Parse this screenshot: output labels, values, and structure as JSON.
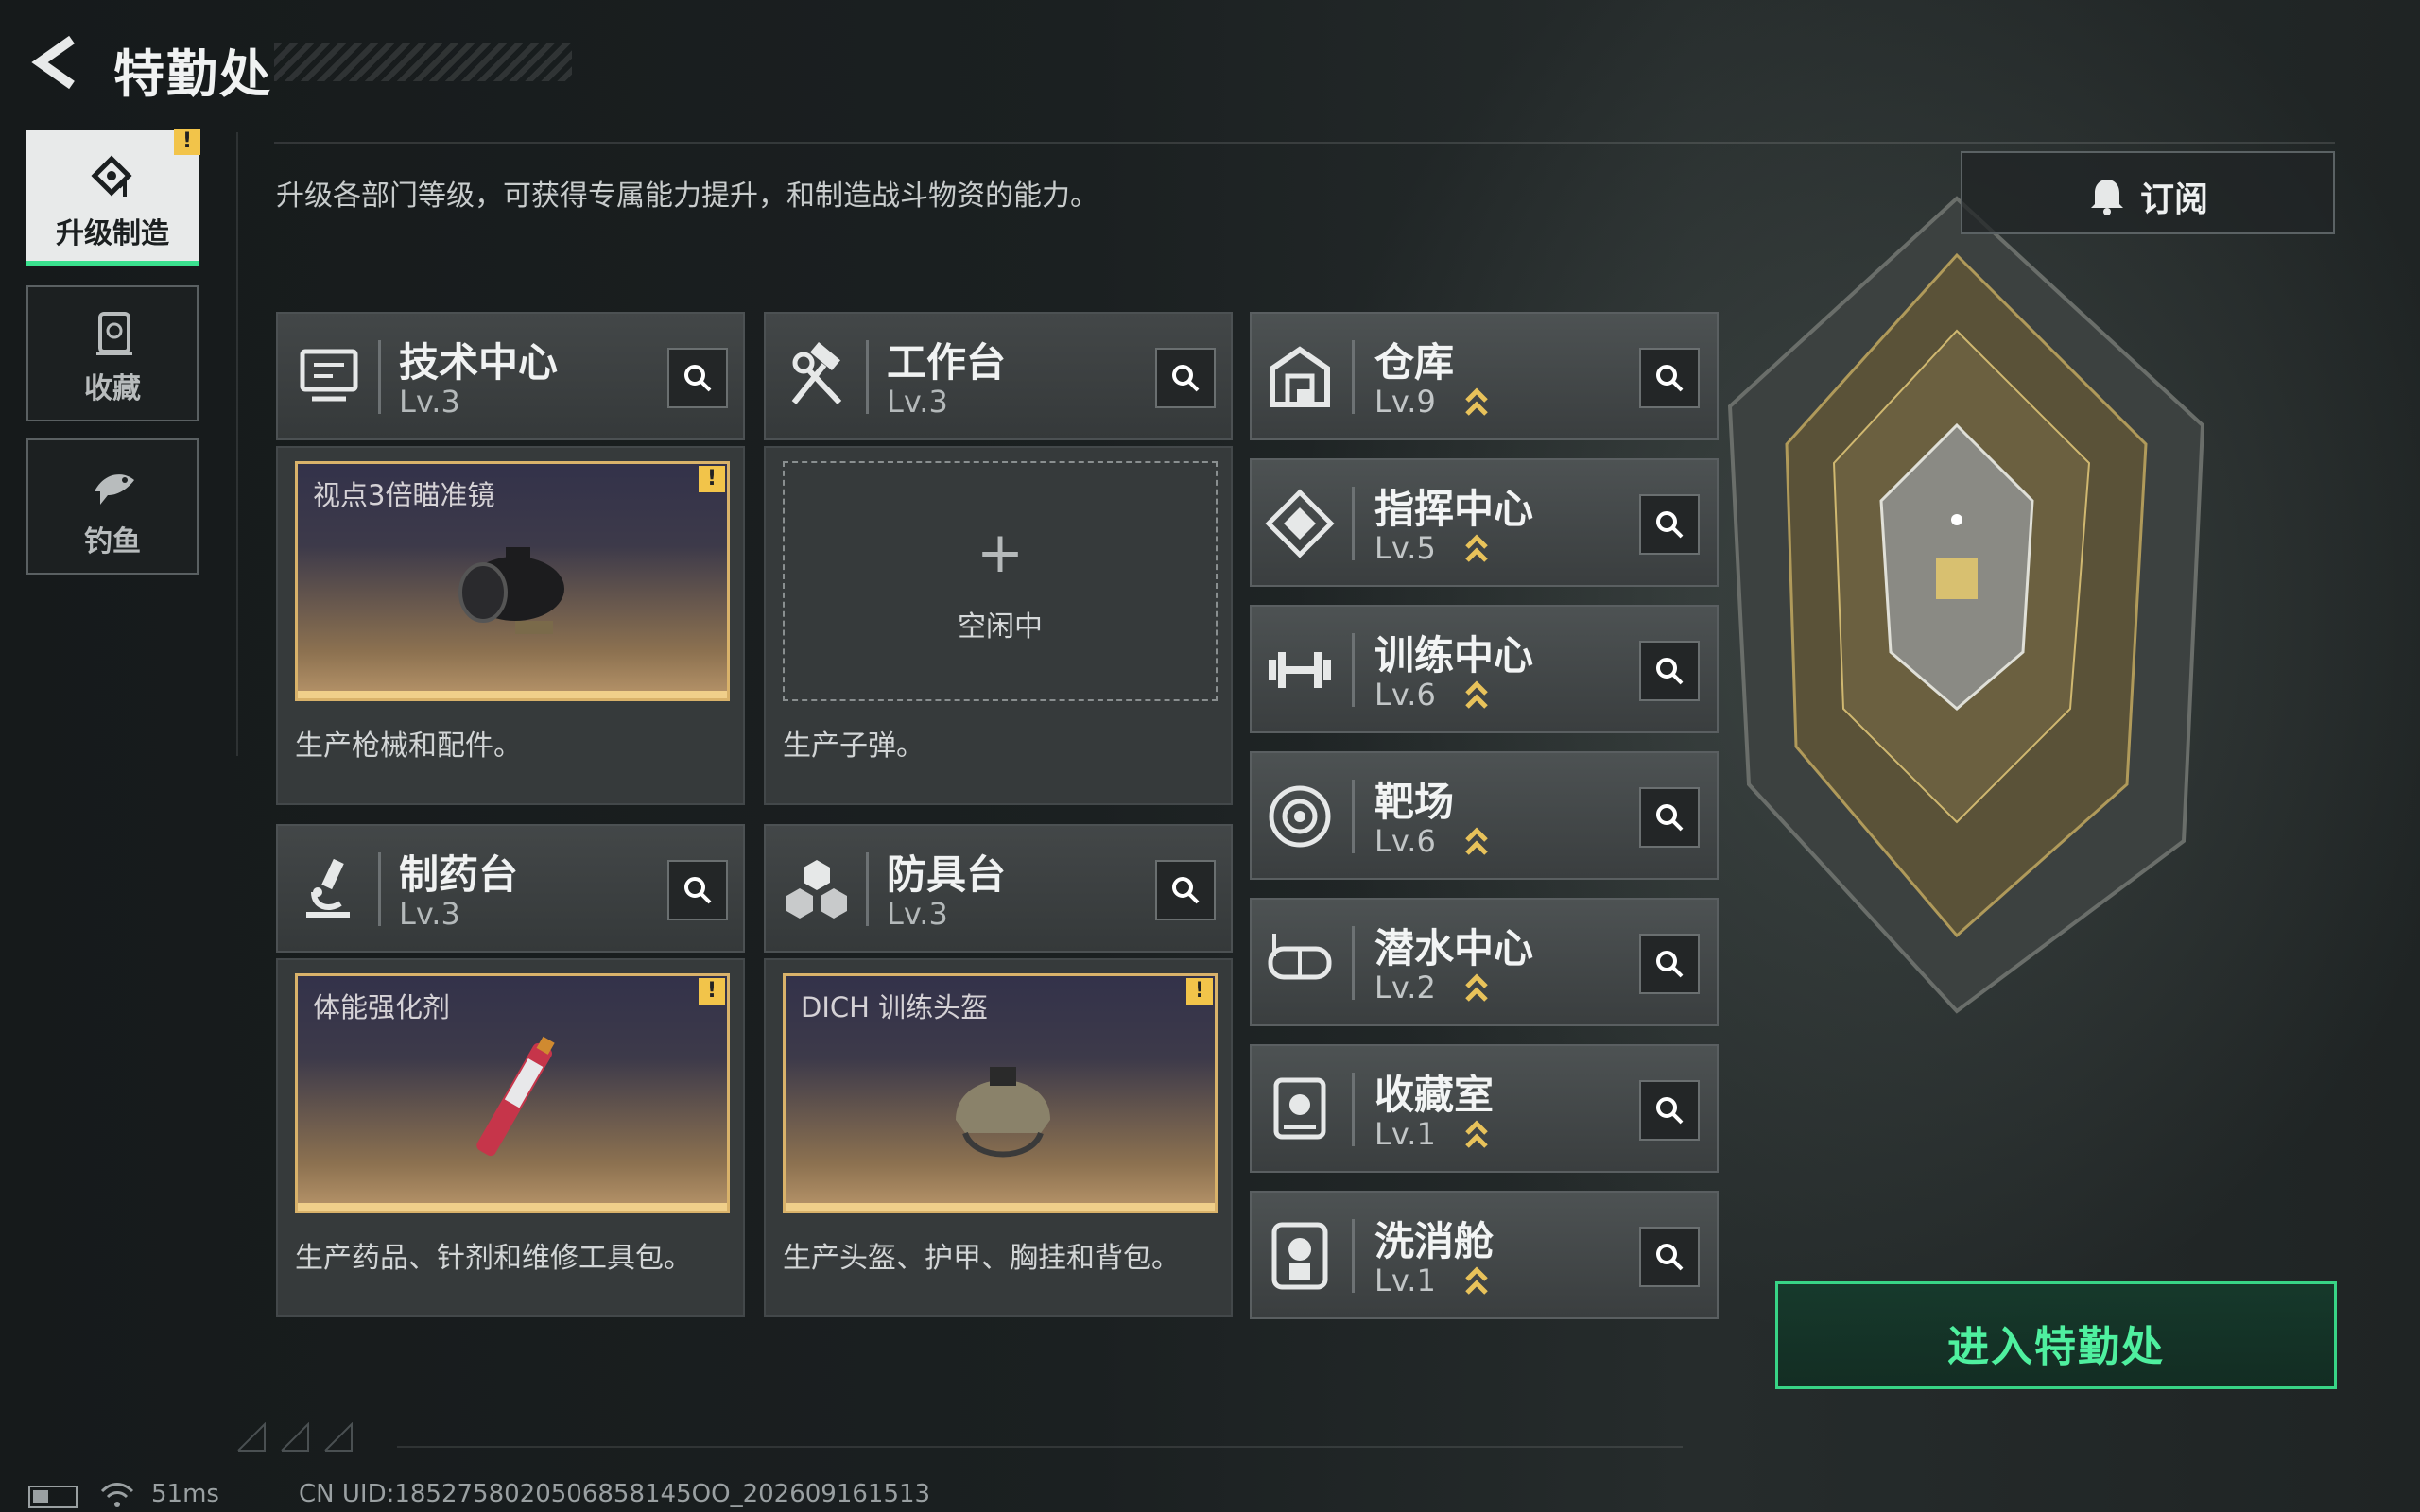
{
  "header": {
    "title": "特勤处",
    "subtitle": "升级各部门等级，可获得专属能力提升，和制造战斗物资的能力。",
    "subscribe_label": "订阅"
  },
  "sidebar": {
    "items": [
      {
        "label": "升级制造",
        "icon": "upgrade-build-icon",
        "active": true,
        "alert": "!"
      },
      {
        "label": "收藏",
        "icon": "collection-icon",
        "active": false
      },
      {
        "label": "钓鱼",
        "icon": "fish-icon",
        "active": false
      }
    ]
  },
  "workshops": [
    {
      "name": "技术中心",
      "level": "Lv.3",
      "icon": "tech-center-icon",
      "slot": {
        "item": "视点3倍瞄准镜",
        "alert": "!"
      },
      "description": "生产枪械和配件。"
    },
    {
      "name": "工作台",
      "level": "Lv.3",
      "icon": "hammer-wrench-icon",
      "slot": {
        "empty": true,
        "plus": "+",
        "idle_label": "空闲中"
      },
      "description": "生产子弹。"
    },
    {
      "name": "制药台",
      "level": "Lv.3",
      "icon": "microscope-icon",
      "slot": {
        "item": "体能强化剂",
        "alert": "!"
      },
      "description": "生产药品、针剂和维修工具包。"
    },
    {
      "name": "防具台",
      "level": "Lv.3",
      "icon": "armor-cubes-icon",
      "slot": {
        "item": "DICH 训练头盔",
        "alert": "!"
      },
      "description": "生产头盔、护甲、胸挂和背包。"
    }
  ],
  "facilities": [
    {
      "name": "仓库",
      "level": "Lv.9",
      "icon": "warehouse-icon",
      "upgradeable": true
    },
    {
      "name": "指挥中心",
      "level": "Lv.5",
      "icon": "command-center-icon",
      "upgradeable": true
    },
    {
      "name": "训练中心",
      "level": "Lv.6",
      "icon": "dumbbell-icon",
      "upgradeable": true
    },
    {
      "name": "靶场",
      "level": "Lv.6",
      "icon": "target-icon",
      "upgradeable": true
    },
    {
      "name": "潜水中心",
      "level": "Lv.2",
      "icon": "diving-mask-icon",
      "upgradeable": true
    },
    {
      "name": "收藏室",
      "level": "Lv.1",
      "icon": "collection-room-icon",
      "upgradeable": true
    },
    {
      "name": "洗消舱",
      "level": "Lv.1",
      "icon": "decontamination-icon",
      "upgradeable": true
    }
  ],
  "enter_button_label": "进入特勤处",
  "status_bar": {
    "ping": "51ms",
    "uid": "CN UID:1852758020506858145OO_202609161513"
  },
  "colors": {
    "accent_green": "#3ae08e",
    "alert_yellow": "#f2c44a",
    "slot_border_gold": "#d9b26a",
    "upgrade_arrow": "#e8c25a"
  }
}
